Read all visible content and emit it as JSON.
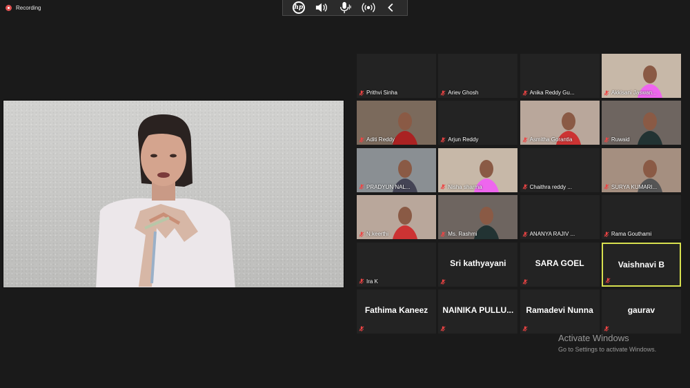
{
  "recording": {
    "label": "Recording"
  },
  "toolbar": {
    "icons": [
      "hp-logo-icon",
      "speaker-icon",
      "microphone-icon",
      "broadcast-icon",
      "chevron-left-icon"
    ]
  },
  "participants": [
    {
      "name": "Prithvi Sinha",
      "video": false,
      "muted": true
    },
    {
      "name": "Ariev Ghosh",
      "video": false,
      "muted": true
    },
    {
      "name": "Anika Reddy Gu...",
      "video": false,
      "muted": true
    },
    {
      "name": "Akkisani Jaswan...",
      "video": true,
      "muted": true
    },
    {
      "name": "Aditi Reddy",
      "video": true,
      "muted": true
    },
    {
      "name": "Arjun Reddy",
      "video": false,
      "muted": true
    },
    {
      "name": "Asmitha Gorantla",
      "video": true,
      "muted": true
    },
    {
      "name": "Ruwaid",
      "video": true,
      "muted": true
    },
    {
      "name": "PRADYUN NAL...",
      "video": true,
      "muted": true
    },
    {
      "name": "Nisha sharma",
      "video": true,
      "muted": true
    },
    {
      "name": "Chaithra reddy ...",
      "video": false,
      "muted": true
    },
    {
      "name": "SURYA KUMARI...",
      "video": true,
      "muted": true
    },
    {
      "name": "N.keerthi",
      "video": true,
      "muted": true
    },
    {
      "name": "Ms. Rashmi",
      "video": true,
      "muted": true
    },
    {
      "name": "ANANYA RAJIV ...",
      "video": false,
      "muted": true
    },
    {
      "name": "Rama Gouthami",
      "video": false,
      "muted": true
    },
    {
      "name": "Ira K",
      "video": false,
      "muted": true
    },
    {
      "name": "Sri kathyayani",
      "video": false,
      "muted": true,
      "display": "big"
    },
    {
      "name": "SARA GOEL",
      "video": false,
      "muted": true,
      "display": "big"
    },
    {
      "name": "Vaishnavi B",
      "video": false,
      "muted": true,
      "display": "big",
      "active": true
    },
    {
      "name": "Fathima Kaneez",
      "video": false,
      "muted": true,
      "display": "big"
    },
    {
      "name": "NAINIKA PULLU...",
      "video": false,
      "muted": true,
      "display": "big"
    },
    {
      "name": "Ramadevi Nunna",
      "video": false,
      "muted": true,
      "display": "big"
    },
    {
      "name": "gaurav",
      "video": false,
      "muted": true,
      "display": "big"
    }
  ],
  "watermark": {
    "line1": "Activate Windows",
    "line2": "Go to Settings to activate Windows."
  }
}
